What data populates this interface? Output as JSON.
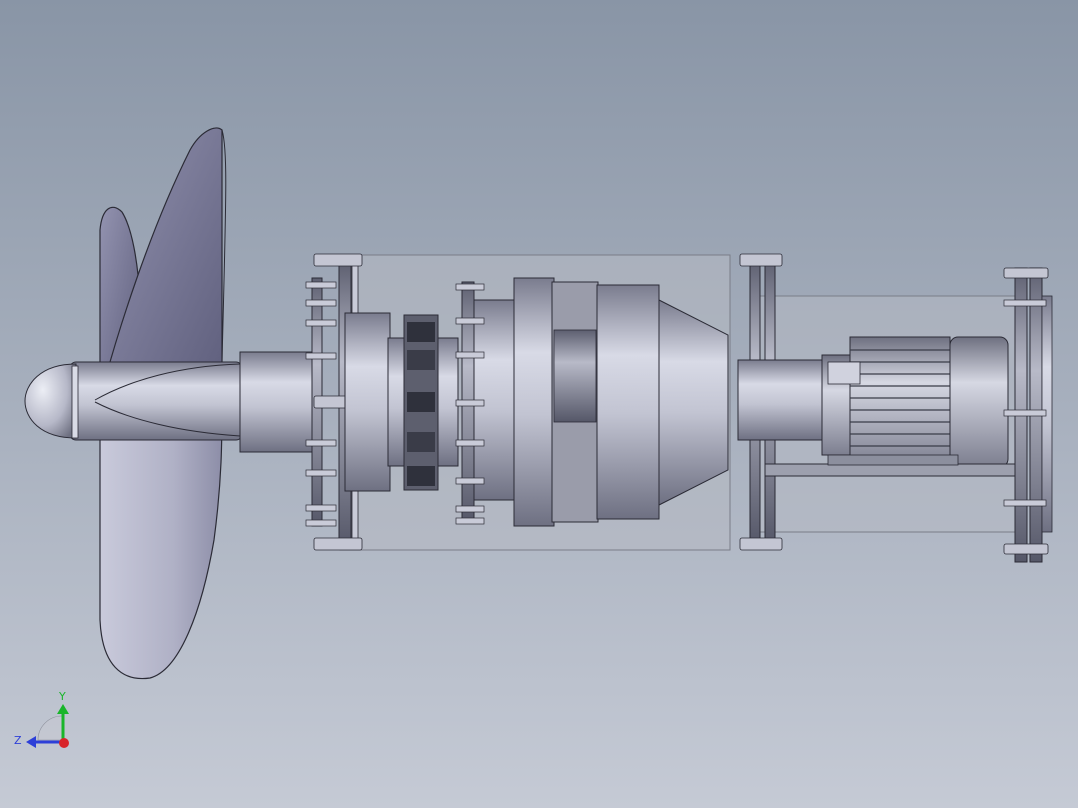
{
  "viewport": {
    "background_top": "#8995a6",
    "background_bottom": "#c5cad5"
  },
  "model": {
    "part_light": "#d9dbe6",
    "part_mid": "#a9abbb",
    "part_dark": "#6f7183",
    "blade_light": "#d8d9e8",
    "blade_dark": "#6a6a88",
    "housing_color": "#b2b6c0",
    "edge_color": "#2b2b36"
  },
  "triad": {
    "y_label": "Y",
    "z_label": "Z",
    "y_color": "#19b52a",
    "z_color": "#2d3fd8",
    "x_color": "#d8242a",
    "icon": "coordinate-triad-icon"
  }
}
